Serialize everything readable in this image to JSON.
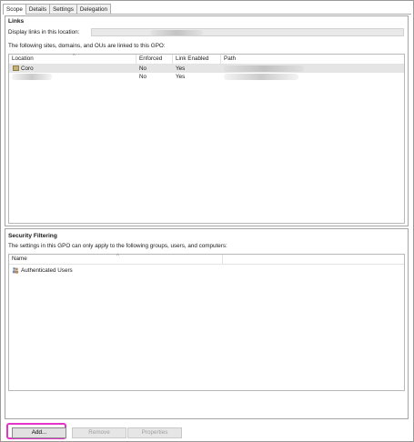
{
  "tabs": [
    {
      "label": "Scope",
      "active": true
    },
    {
      "label": "Details",
      "active": false
    },
    {
      "label": "Settings",
      "active": false
    },
    {
      "label": "Delegation",
      "active": false
    }
  ],
  "links": {
    "title": "Links",
    "display_label": "Display links in this location:",
    "description": "The following sites, domains, and OUs are linked to this GPO:",
    "columns": [
      "Location",
      "Enforced",
      "Link Enabled",
      "Path"
    ],
    "rows": [
      {
        "location": "Coro",
        "enforced": "No",
        "link_enabled": "Yes"
      },
      {
        "location": "",
        "enforced": "No",
        "link_enabled": "Yes"
      }
    ]
  },
  "security": {
    "title": "Security Filtering",
    "description": "The settings in this GPO can only apply to the following groups, users, and computers:",
    "columns": [
      "Name"
    ],
    "rows": [
      {
        "name": "Authenticated Users"
      }
    ]
  },
  "buttons": {
    "add": "Add...",
    "remove": "Remove",
    "properties": "Properties"
  },
  "colors": {
    "highlight": "#e535c8",
    "selected_row": "#e5e5e5"
  }
}
